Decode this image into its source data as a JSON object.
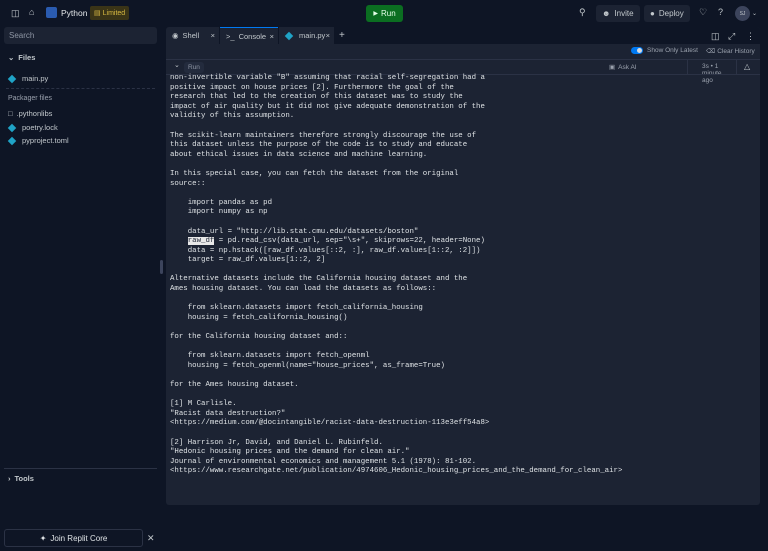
{
  "topbar": {
    "app_name": "Python",
    "plan_badge": "Limited",
    "run_label": "Run",
    "invite_label": "Invite",
    "deploy_label": "Deploy",
    "avatar_initials": "SJ"
  },
  "sidebar": {
    "search_placeholder": "Search",
    "files_heading": "Files",
    "files": [
      {
        "name": "main.py"
      }
    ],
    "packager_heading": "Packager files",
    "packager_files": [
      {
        "name": ".pythonlibs",
        "type": "folder"
      },
      {
        "name": "poetry.lock",
        "type": "file"
      },
      {
        "name": "pyproject.toml",
        "type": "file"
      }
    ],
    "tools_label": "Tools",
    "join_core_label": "Join Replit Core"
  },
  "tabs": [
    {
      "label": "Shell"
    },
    {
      "label": "Console",
      "active": true
    },
    {
      "label": "main.py"
    }
  ],
  "console_toolbar": {
    "show_only_latest_label": "Show Only Latest",
    "show_only_latest_on": true,
    "clear_history_label": "Clear History",
    "run_label": "Run",
    "ask_ai_label": "Ask AI",
    "timing": "3s • 1 minute ago"
  },
  "console": {
    "lines_before": [
      "non-invertible variable \"B\" assuming that racial self-segregation had a",
      "positive impact on house prices [2]. Furthermore the goal of the",
      "research that led to the creation of this dataset was to study the",
      "impact of air quality but it did not give adequate demonstration of the",
      "validity of this assumption.",
      "",
      "The scikit-learn maintainers therefore strongly discourage the use of",
      "this dataset unless the purpose of the code is to study and educate",
      "about ethical issues in data science and machine learning.",
      "",
      "In this special case, you can fetch the dataset from the original",
      "source::",
      "",
      "    import pandas as pd",
      "    import numpy as np",
      "",
      "    data_url = \"http://lib.stat.cmu.edu/datasets/boston\""
    ],
    "highlight_indent": "    ",
    "highlight_word": "raw_df",
    "highlight_rest": " = pd.read_csv(data_url, sep=\"\\s+\", skiprows=22, header=None)",
    "lines_after": [
      "    data = np.hstack([raw_df.values[::2, :], raw_df.values[1::2, :2]])",
      "    target = raw_df.values[1::2, 2]",
      "",
      "Alternative datasets include the California housing dataset and the",
      "Ames housing dataset. You can load the datasets as follows::",
      "",
      "    from sklearn.datasets import fetch_california_housing",
      "    housing = fetch_california_housing()",
      "",
      "for the California housing dataset and::",
      "",
      "    from sklearn.datasets import fetch_openml",
      "    housing = fetch_openml(name=\"house_prices\", as_frame=True)",
      "",
      "for the Ames housing dataset.",
      "",
      "[1] M Carlisle.",
      "\"Racist data destruction?\"",
      "<https://medium.com/@docintangible/racist-data-destruction-113e3eff54a8>",
      "",
      "[2] Harrison Jr, David, and Daniel L. Rubinfeld.",
      "\"Hedonic housing prices and the demand for clean air.\"",
      "Journal of environmental economics and management 5.1 (1978): 81-102.",
      "<https://www.researchgate.net/publication/4974606_Hedonic_housing_prices_and_the_demand_for_clean_air>"
    ]
  }
}
